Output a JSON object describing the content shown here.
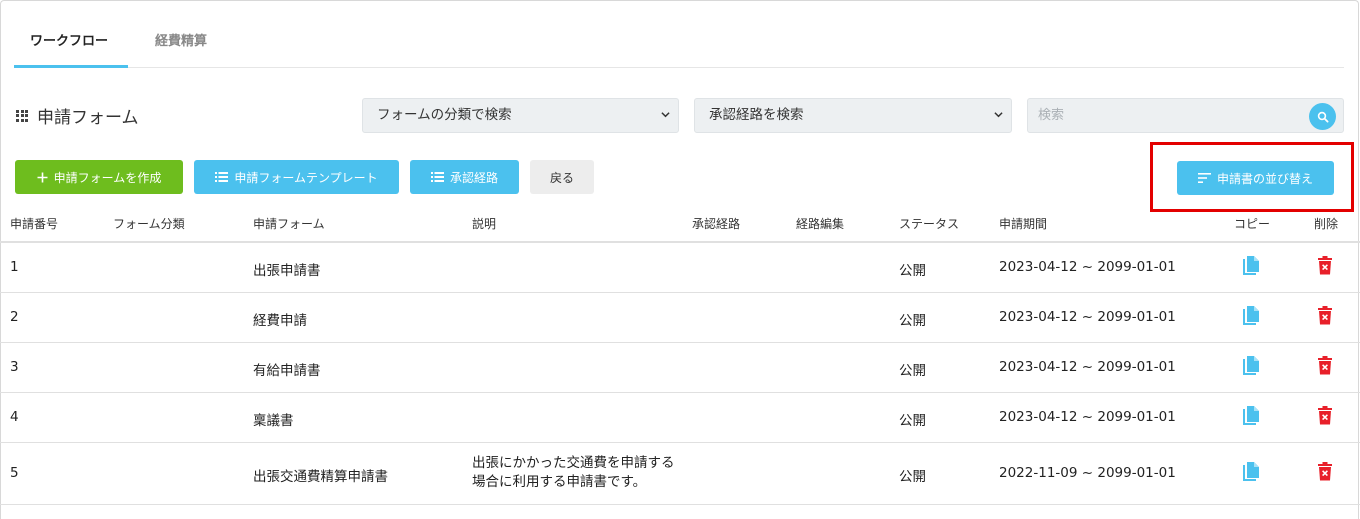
{
  "tabs": [
    {
      "label": "ワークフロー"
    },
    {
      "label": "経費精算"
    }
  ],
  "header": {
    "title": "申請フォーム",
    "category_select": "フォームの分類で検索",
    "route_select": "承認経路を検索",
    "search_placeholder": "検索"
  },
  "toolbar": {
    "create_label": "申請フォームを作成",
    "template_label": "申請フォームテンプレート",
    "route_label": "承認経路",
    "back_label": "戻る",
    "sort_label": "申請書の並び替え"
  },
  "table": {
    "columns": [
      "申請番号",
      "フォーム分類",
      "申請フォーム",
      "説明",
      "承認経路",
      "経路編集",
      "ステータス",
      "申請期間",
      "コピー",
      "削除"
    ],
    "rows": [
      {
        "no": "1",
        "category": "",
        "form": "出張申請書",
        "desc": "",
        "route": "",
        "edit": "",
        "status": "公開",
        "period": "2023-04-12 ~ 2099-01-01"
      },
      {
        "no": "2",
        "category": "",
        "form": "経費申請",
        "desc": "",
        "route": "",
        "edit": "",
        "status": "公開",
        "period": "2023-04-12 ~ 2099-01-01"
      },
      {
        "no": "3",
        "category": "",
        "form": "有給申請書",
        "desc": "",
        "route": "",
        "edit": "",
        "status": "公開",
        "period": "2023-04-12 ~ 2099-01-01"
      },
      {
        "no": "4",
        "category": "",
        "form": "稟議書",
        "desc": "",
        "route": "",
        "edit": "",
        "status": "公開",
        "period": "2023-04-12 ~ 2099-01-01"
      },
      {
        "no": "5",
        "category": "",
        "form": "出張交通費精算申請書",
        "desc": "出張にかかった交通費を申請する場合に利用する申請書です。",
        "route": "",
        "edit": "",
        "status": "公開",
        "period": "2022-11-09 ~ 2099-01-01"
      }
    ]
  },
  "colors": {
    "accent": "#4bc1ee",
    "create": "#6ebd1e",
    "delete": "#e8202a",
    "highlight": "#e30000"
  }
}
